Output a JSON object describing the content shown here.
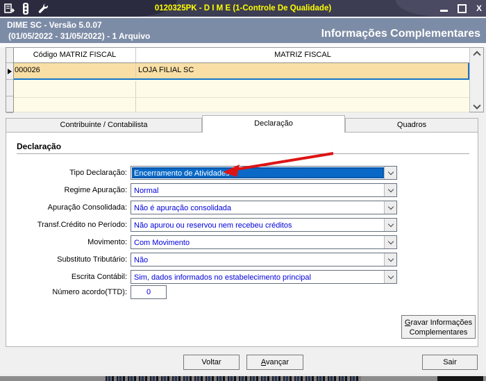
{
  "window": {
    "title": "0120325PK - D I M E (1-Controle De Qualidade)",
    "controls": {
      "close": "X"
    },
    "toolbar_icons": [
      "notes-icon",
      "traffic-light-icon",
      "wrench-icon"
    ]
  },
  "header": {
    "app_version": "DIME SC - Versão 5.0.07",
    "period": "(01/05/2022 - 31/05/2022) - 1 Arquivo",
    "page_title": "Informações Complementares"
  },
  "grid": {
    "columns": [
      "Código MATRIZ FISCAL",
      "MATRIZ FISCAL"
    ],
    "rows": [
      {
        "codigo": "000026",
        "matriz": "LOJA FILIAL SC",
        "selected": true
      }
    ]
  },
  "tabs": [
    {
      "label": "Contribuinte / Contabilista",
      "active": false
    },
    {
      "label": "Declaração",
      "active": true
    },
    {
      "label": "Quadros",
      "active": false
    }
  ],
  "form": {
    "group_title": "Declaração",
    "fields": [
      {
        "label": "Tipo Declaração:",
        "value": "Encerramento de Atividades",
        "type": "select",
        "focused": true
      },
      {
        "label": "Regime Apuração:",
        "value": "Normal",
        "type": "select",
        "focused": false
      },
      {
        "label": "Apuração Consolidada:",
        "value": "Não é apuração consolidada",
        "type": "select",
        "focused": false
      },
      {
        "label": "Transf.Crédito no Período:",
        "value": "Não apurou ou reservou nem recebeu créditos",
        "type": "select",
        "focused": false
      },
      {
        "label": "Movimento:",
        "value": "Com Movimento",
        "type": "select",
        "focused": false
      },
      {
        "label": "Substituto Tributário:",
        "value": "Não",
        "type": "select",
        "focused": false
      },
      {
        "label": "Escrita Contábil:",
        "value": "Sim, dados informados no estabelecimento principal",
        "type": "select",
        "focused": false
      },
      {
        "label": "Número acordo(TTD):",
        "value": "0",
        "type": "input",
        "focused": false
      }
    ]
  },
  "actions": {
    "gravar_accel": "G",
    "gravar_rest": "ravar Informações",
    "gravar_line2": "Complementares",
    "voltar": "Voltar",
    "avancar_accel": "A",
    "avancar_rest": "vançar",
    "sair": "Sair"
  },
  "annotation": {
    "type": "arrow",
    "color": "#dd1414",
    "points_at": "Tipo Declaração combobox"
  },
  "colors": {
    "titlebar_bg": "#3c3c52",
    "title_text": "#ffff00",
    "header_bg": "#7d8ca6",
    "selected_row_bg": "#f9dfa6",
    "selected_row_border": "#1673c7",
    "grid_row_bg": "#fffbe9",
    "field_text_blue": "#0000dd",
    "focused_combo_bg": "#0a69c7",
    "window_bg": "#f0f0f0"
  }
}
